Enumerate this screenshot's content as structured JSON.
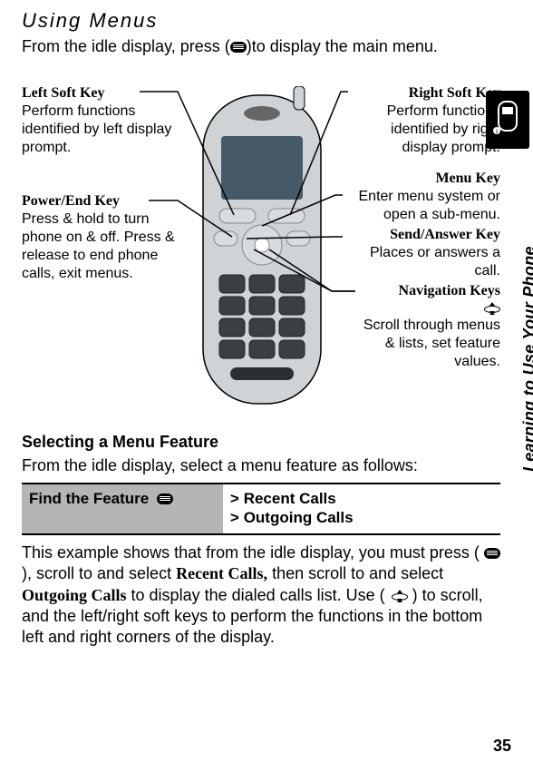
{
  "page_number": "35",
  "sidebar_label": "Learning to Use Your Phone",
  "section_title": "Using Menus",
  "intro_before": "From the idle display, press (",
  "intro_after": ")to display the main menu.",
  "callouts": {
    "left_soft": {
      "head": "Left Soft Key",
      "body": "Perform functions identified by left display prompt."
    },
    "power_end": {
      "head": "Power/End Key",
      "body": "Press & hold to turn phone on & off. Press & release to end phone calls, exit menus."
    },
    "right_soft": {
      "head": "Right Soft Key",
      "body": "Perform functions identified by right display prompt."
    },
    "menu_key": {
      "head": "Menu Key",
      "body": "Enter menu system or open a sub-menu."
    },
    "send_answer": {
      "head": "Send/Answer Key",
      "body": "Places or answers a call."
    },
    "nav_keys": {
      "head": "Navigation Keys",
      "body": "Scroll through menus & lists, set feature values."
    }
  },
  "subheading": "Selecting a Menu Feature",
  "sub_intro": "From the idle display, select a menu feature as follows:",
  "table": {
    "find_label": "Find the Feature",
    "row1_sym": ">",
    "row1": "Recent Calls",
    "row2_sym": ">",
    "row2": "Outgoing Calls"
  },
  "example_1": "This example shows that from the idle display, you must press (",
  "example_2": "), scroll to and select ",
  "example_recent": "Recent Calls,",
  "example_3": " then scroll to and select ",
  "example_outgoing": "Outgoing Calls",
  "example_4": " to display the dialed calls list. Use ( ",
  "example_5": " ) to scroll, and the left/right soft keys to perform the functions in the bottom left and right corners of the display."
}
